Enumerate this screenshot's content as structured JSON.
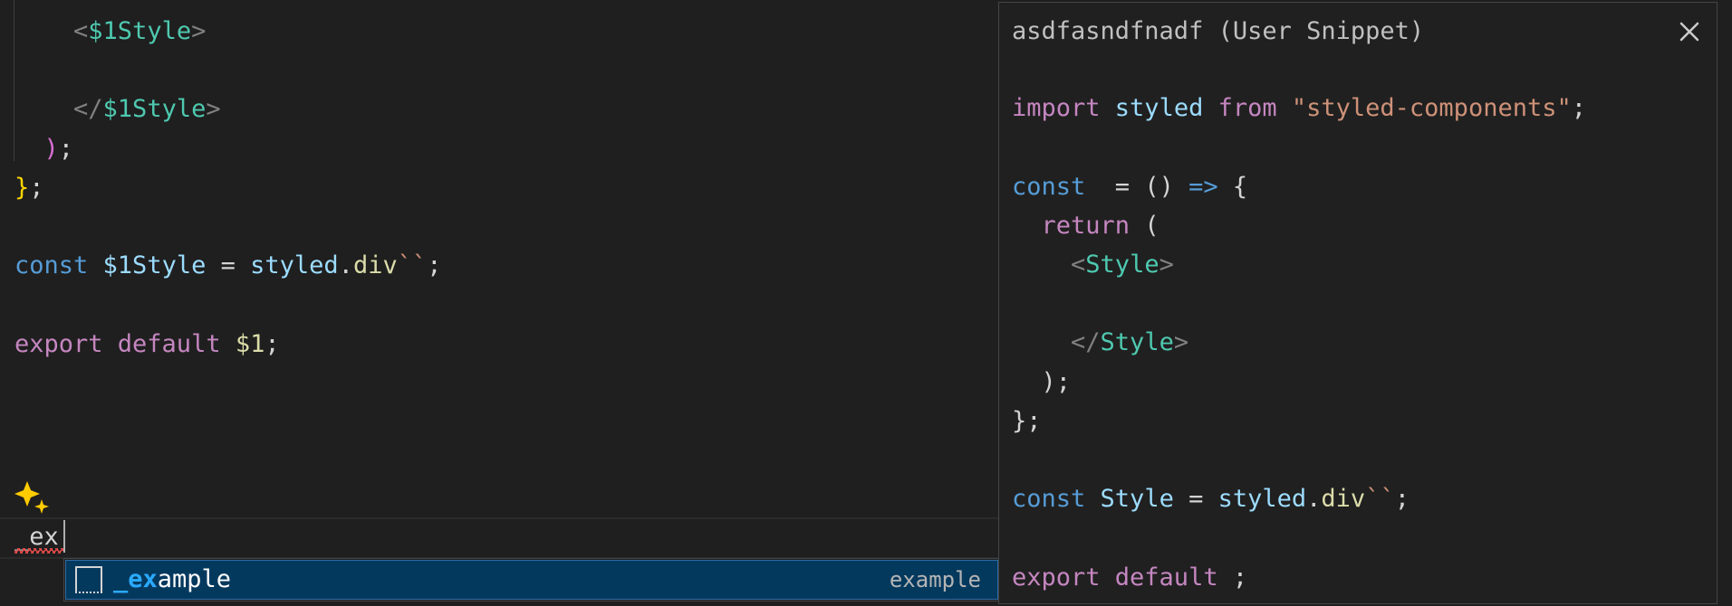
{
  "editor": {
    "lines": [
      {
        "indent": "    ",
        "tokens": [
          {
            "t": "<",
            "c": "punct"
          },
          {
            "t": "$1Style",
            "c": "tag"
          },
          {
            "t": ">",
            "c": "punct"
          }
        ]
      },
      {
        "indent": "",
        "tokens": []
      },
      {
        "indent": "    ",
        "tokens": [
          {
            "t": "</",
            "c": "punct"
          },
          {
            "t": "$1Style",
            "c": "tag"
          },
          {
            "t": ">",
            "c": "punct"
          }
        ]
      },
      {
        "indent": "  ",
        "tokens": [
          {
            "t": ")",
            "c": "pink"
          },
          {
            "t": ";",
            "c": "plain"
          }
        ]
      },
      {
        "indent": "",
        "tokens": [
          {
            "t": "}",
            "c": "yellow"
          },
          {
            "t": ";",
            "c": "plain"
          }
        ]
      },
      {
        "indent": "",
        "tokens": []
      },
      {
        "indent": "",
        "tokens": [
          {
            "t": "const ",
            "c": "kw"
          },
          {
            "t": "$1Style",
            "c": "var"
          },
          {
            "t": " = ",
            "c": "plain"
          },
          {
            "t": "styled",
            "c": "var"
          },
          {
            "t": ".",
            "c": "plain"
          },
          {
            "t": "div",
            "c": "fn"
          },
          {
            "t": "``",
            "c": "str"
          },
          {
            "t": ";",
            "c": "plain"
          }
        ]
      },
      {
        "indent": "",
        "tokens": []
      },
      {
        "indent": "",
        "tokens": [
          {
            "t": "export default ",
            "c": "kw2"
          },
          {
            "t": "$1",
            "c": "fn"
          },
          {
            "t": ";",
            "c": "plain"
          }
        ]
      }
    ],
    "typed_text": "_ex"
  },
  "suggest": {
    "label_match": "_ex",
    "label_rest": "ample",
    "detail": "example"
  },
  "details": {
    "title": "asdfasndfnadf (User Snippet)",
    "lines": [
      {
        "indent": "",
        "tokens": []
      },
      {
        "indent": "",
        "tokens": [
          {
            "t": "import ",
            "c": "kw2"
          },
          {
            "t": "styled ",
            "c": "var"
          },
          {
            "t": "from ",
            "c": "kw2"
          },
          {
            "t": "\"styled-components\"",
            "c": "str"
          },
          {
            "t": ";",
            "c": "plain"
          }
        ]
      },
      {
        "indent": "",
        "tokens": []
      },
      {
        "indent": "",
        "tokens": [
          {
            "t": "const ",
            "c": "kw"
          },
          {
            "t": " = () ",
            "c": "plain"
          },
          {
            "t": "=>",
            "c": "kw"
          },
          {
            "t": " {",
            "c": "plain"
          }
        ]
      },
      {
        "indent": "  ",
        "tokens": [
          {
            "t": "return",
            "c": "kw2"
          },
          {
            "t": " (",
            "c": "plain"
          }
        ]
      },
      {
        "indent": "    ",
        "tokens": [
          {
            "t": "<",
            "c": "punct"
          },
          {
            "t": "Style",
            "c": "tag"
          },
          {
            "t": ">",
            "c": "punct"
          }
        ]
      },
      {
        "indent": "",
        "tokens": []
      },
      {
        "indent": "    ",
        "tokens": [
          {
            "t": "</",
            "c": "punct"
          },
          {
            "t": "Style",
            "c": "tag"
          },
          {
            "t": ">",
            "c": "punct"
          }
        ]
      },
      {
        "indent": "  ",
        "tokens": [
          {
            "t": ");",
            "c": "plain"
          }
        ]
      },
      {
        "indent": "",
        "tokens": [
          {
            "t": "};",
            "c": "plain"
          }
        ]
      },
      {
        "indent": "",
        "tokens": []
      },
      {
        "indent": "",
        "tokens": [
          {
            "t": "const ",
            "c": "kw"
          },
          {
            "t": "Style",
            "c": "var"
          },
          {
            "t": " = ",
            "c": "plain"
          },
          {
            "t": "styled",
            "c": "var"
          },
          {
            "t": ".",
            "c": "plain"
          },
          {
            "t": "div",
            "c": "fn"
          },
          {
            "t": "``",
            "c": "str"
          },
          {
            "t": ";",
            "c": "plain"
          }
        ]
      },
      {
        "indent": "",
        "tokens": []
      },
      {
        "indent": "",
        "tokens": [
          {
            "t": "export default ",
            "c": "kw2"
          },
          {
            "t": ";",
            "c": "plain"
          }
        ]
      }
    ]
  },
  "icons": {
    "sparkle": "sparkle-icon",
    "snippet": "snippet-icon",
    "close": "close-icon"
  },
  "colors": {
    "background": "#1f1f1f",
    "suggest_selected": "#04395e",
    "match_highlight": "#2aaaff"
  }
}
